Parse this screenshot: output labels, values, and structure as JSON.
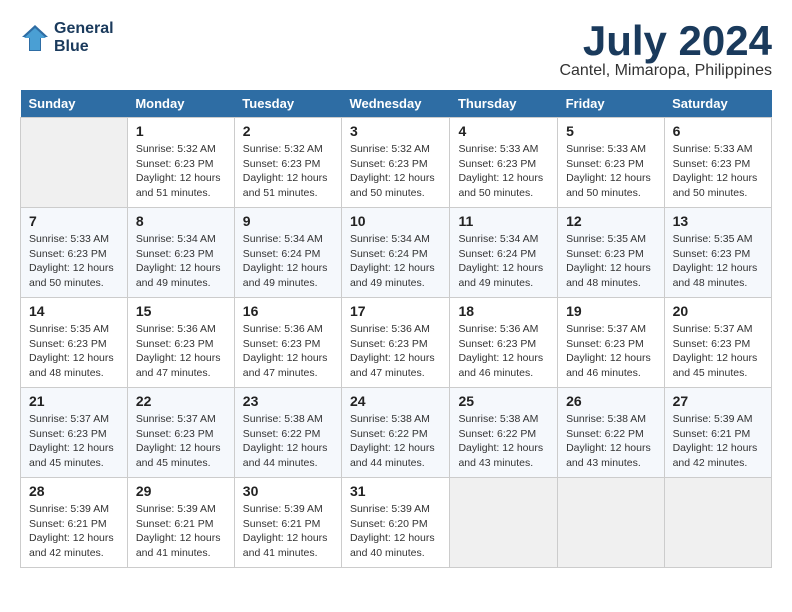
{
  "logo": {
    "line1": "General",
    "line2": "Blue"
  },
  "title": "July 2024",
  "location": "Cantel, Mimaropa, Philippines",
  "days_of_week": [
    "Sunday",
    "Monday",
    "Tuesday",
    "Wednesday",
    "Thursday",
    "Friday",
    "Saturday"
  ],
  "weeks": [
    [
      {
        "num": "",
        "info": ""
      },
      {
        "num": "1",
        "info": "Sunrise: 5:32 AM\nSunset: 6:23 PM\nDaylight: 12 hours\nand 51 minutes."
      },
      {
        "num": "2",
        "info": "Sunrise: 5:32 AM\nSunset: 6:23 PM\nDaylight: 12 hours\nand 51 minutes."
      },
      {
        "num": "3",
        "info": "Sunrise: 5:32 AM\nSunset: 6:23 PM\nDaylight: 12 hours\nand 50 minutes."
      },
      {
        "num": "4",
        "info": "Sunrise: 5:33 AM\nSunset: 6:23 PM\nDaylight: 12 hours\nand 50 minutes."
      },
      {
        "num": "5",
        "info": "Sunrise: 5:33 AM\nSunset: 6:23 PM\nDaylight: 12 hours\nand 50 minutes."
      },
      {
        "num": "6",
        "info": "Sunrise: 5:33 AM\nSunset: 6:23 PM\nDaylight: 12 hours\nand 50 minutes."
      }
    ],
    [
      {
        "num": "7",
        "info": "Sunrise: 5:33 AM\nSunset: 6:23 PM\nDaylight: 12 hours\nand 50 minutes."
      },
      {
        "num": "8",
        "info": "Sunrise: 5:34 AM\nSunset: 6:23 PM\nDaylight: 12 hours\nand 49 minutes."
      },
      {
        "num": "9",
        "info": "Sunrise: 5:34 AM\nSunset: 6:24 PM\nDaylight: 12 hours\nand 49 minutes."
      },
      {
        "num": "10",
        "info": "Sunrise: 5:34 AM\nSunset: 6:24 PM\nDaylight: 12 hours\nand 49 minutes."
      },
      {
        "num": "11",
        "info": "Sunrise: 5:34 AM\nSunset: 6:24 PM\nDaylight: 12 hours\nand 49 minutes."
      },
      {
        "num": "12",
        "info": "Sunrise: 5:35 AM\nSunset: 6:23 PM\nDaylight: 12 hours\nand 48 minutes."
      },
      {
        "num": "13",
        "info": "Sunrise: 5:35 AM\nSunset: 6:23 PM\nDaylight: 12 hours\nand 48 minutes."
      }
    ],
    [
      {
        "num": "14",
        "info": "Sunrise: 5:35 AM\nSunset: 6:23 PM\nDaylight: 12 hours\nand 48 minutes."
      },
      {
        "num": "15",
        "info": "Sunrise: 5:36 AM\nSunset: 6:23 PM\nDaylight: 12 hours\nand 47 minutes."
      },
      {
        "num": "16",
        "info": "Sunrise: 5:36 AM\nSunset: 6:23 PM\nDaylight: 12 hours\nand 47 minutes."
      },
      {
        "num": "17",
        "info": "Sunrise: 5:36 AM\nSunset: 6:23 PM\nDaylight: 12 hours\nand 47 minutes."
      },
      {
        "num": "18",
        "info": "Sunrise: 5:36 AM\nSunset: 6:23 PM\nDaylight: 12 hours\nand 46 minutes."
      },
      {
        "num": "19",
        "info": "Sunrise: 5:37 AM\nSunset: 6:23 PM\nDaylight: 12 hours\nand 46 minutes."
      },
      {
        "num": "20",
        "info": "Sunrise: 5:37 AM\nSunset: 6:23 PM\nDaylight: 12 hours\nand 45 minutes."
      }
    ],
    [
      {
        "num": "21",
        "info": "Sunrise: 5:37 AM\nSunset: 6:23 PM\nDaylight: 12 hours\nand 45 minutes."
      },
      {
        "num": "22",
        "info": "Sunrise: 5:37 AM\nSunset: 6:23 PM\nDaylight: 12 hours\nand 45 minutes."
      },
      {
        "num": "23",
        "info": "Sunrise: 5:38 AM\nSunset: 6:22 PM\nDaylight: 12 hours\nand 44 minutes."
      },
      {
        "num": "24",
        "info": "Sunrise: 5:38 AM\nSunset: 6:22 PM\nDaylight: 12 hours\nand 44 minutes."
      },
      {
        "num": "25",
        "info": "Sunrise: 5:38 AM\nSunset: 6:22 PM\nDaylight: 12 hours\nand 43 minutes."
      },
      {
        "num": "26",
        "info": "Sunrise: 5:38 AM\nSunset: 6:22 PM\nDaylight: 12 hours\nand 43 minutes."
      },
      {
        "num": "27",
        "info": "Sunrise: 5:39 AM\nSunset: 6:21 PM\nDaylight: 12 hours\nand 42 minutes."
      }
    ],
    [
      {
        "num": "28",
        "info": "Sunrise: 5:39 AM\nSunset: 6:21 PM\nDaylight: 12 hours\nand 42 minutes."
      },
      {
        "num": "29",
        "info": "Sunrise: 5:39 AM\nSunset: 6:21 PM\nDaylight: 12 hours\nand 41 minutes."
      },
      {
        "num": "30",
        "info": "Sunrise: 5:39 AM\nSunset: 6:21 PM\nDaylight: 12 hours\nand 41 minutes."
      },
      {
        "num": "31",
        "info": "Sunrise: 5:39 AM\nSunset: 6:20 PM\nDaylight: 12 hours\nand 40 minutes."
      },
      {
        "num": "",
        "info": ""
      },
      {
        "num": "",
        "info": ""
      },
      {
        "num": "",
        "info": ""
      }
    ]
  ]
}
